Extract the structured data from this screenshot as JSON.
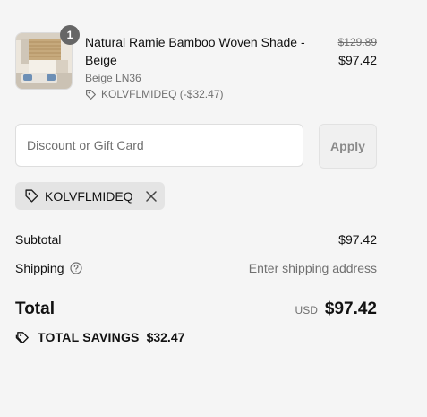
{
  "product": {
    "title": "Natural Ramie Bamboo Woven Shade - Beige",
    "variant": "Beige LN36",
    "discount_line": "KOLVFLMIDEQ (-$32.47)",
    "quantity": "1",
    "compare_price": "$129.89",
    "price": "$97.42"
  },
  "discount": {
    "placeholder": "Discount or Gift Card",
    "apply_label": "Apply",
    "applied_code": "KOLVFLMIDEQ"
  },
  "summary": {
    "subtotal_label": "Subtotal",
    "subtotal_value": "$97.42",
    "shipping_label": "Shipping",
    "shipping_value": "Enter shipping address",
    "total_label": "Total",
    "currency": "USD",
    "total_value": "$97.42",
    "savings_label": "TOTAL SAVINGS",
    "savings_value": "$32.47"
  },
  "colors": {
    "background": "#f5f5f5",
    "muted_text": "#707070",
    "badge": "#666666",
    "chip": "#e4e4e4"
  },
  "icons": [
    "tag-icon",
    "close-icon",
    "help-circle-icon",
    "tags-icon"
  ]
}
